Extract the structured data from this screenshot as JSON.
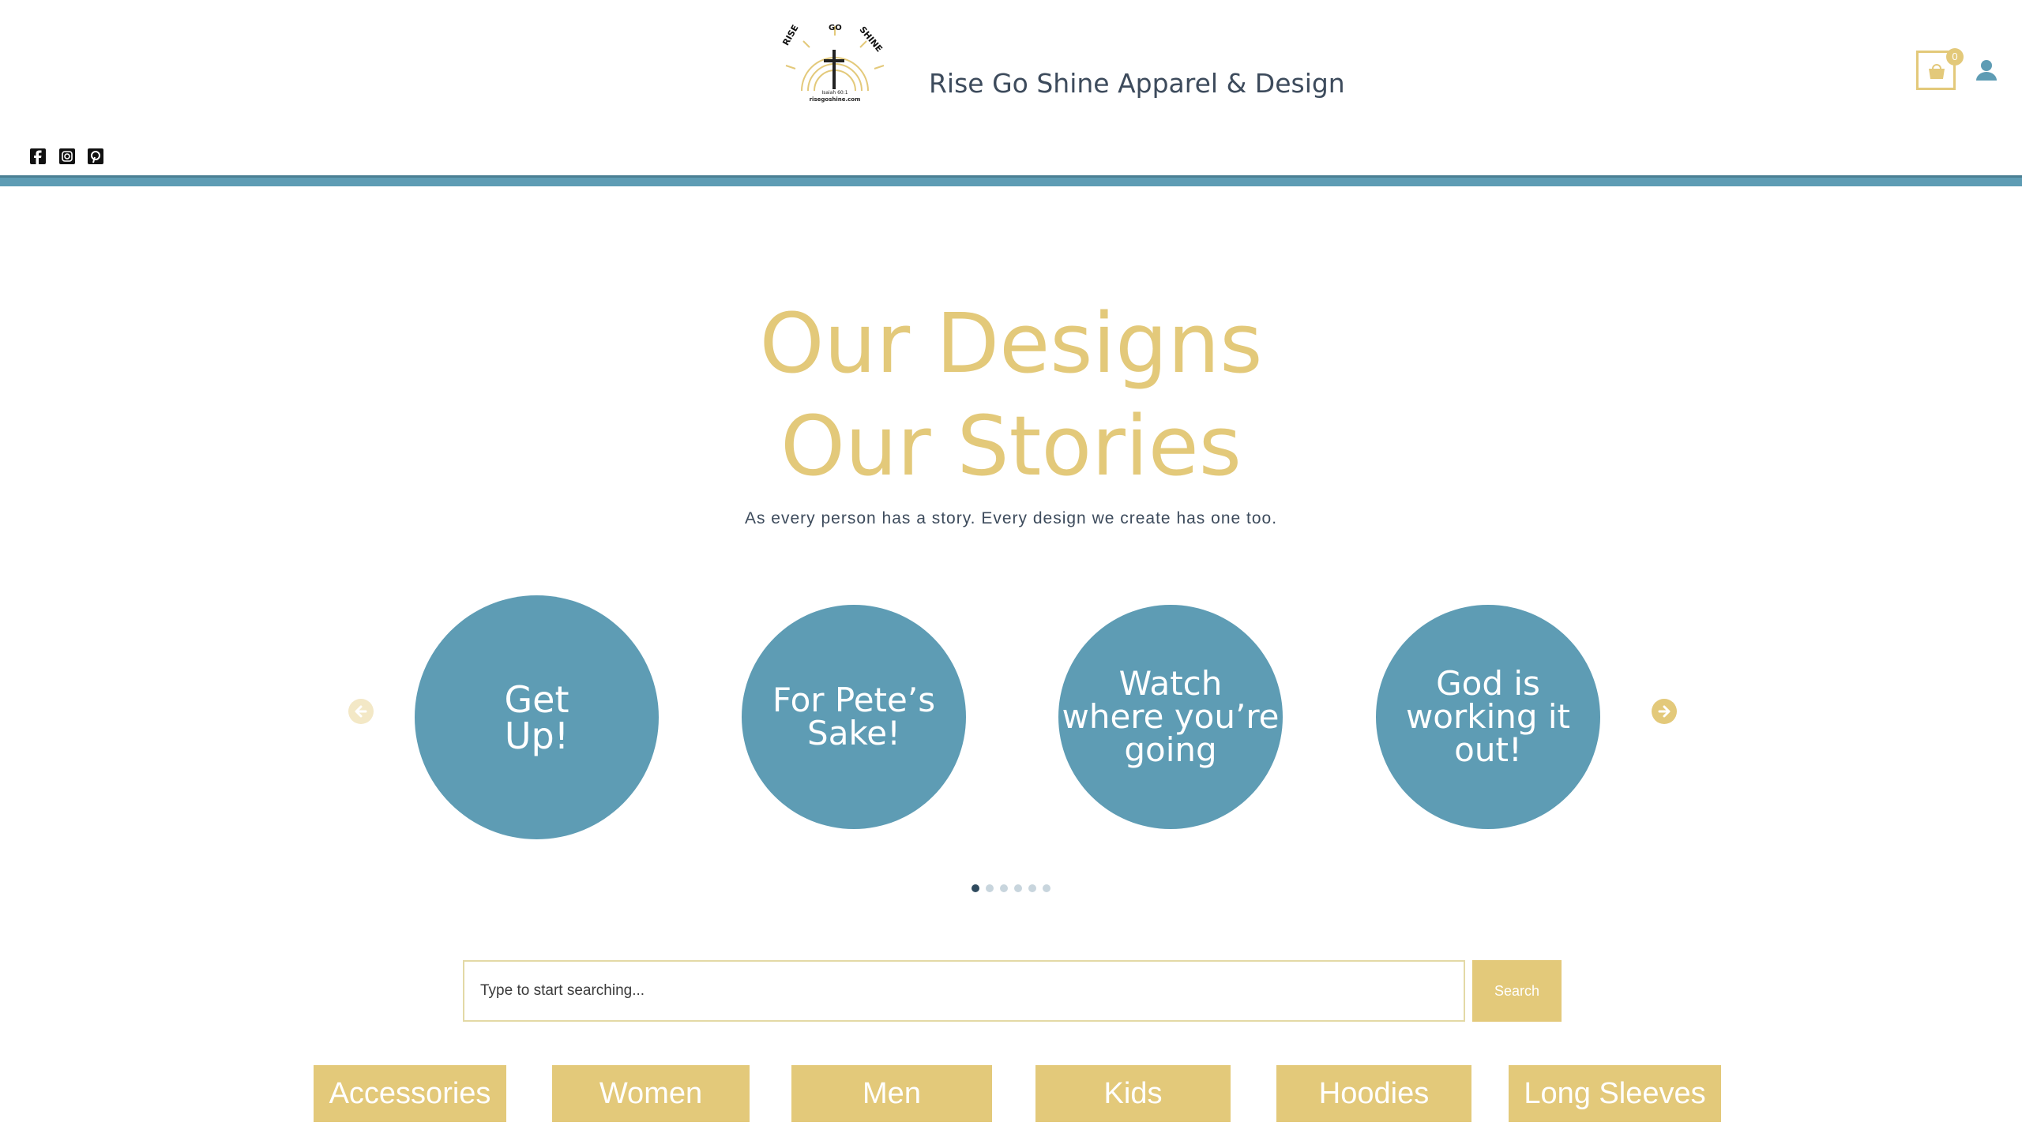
{
  "header": {
    "site_title": "Rise Go Shine Apparel & Design",
    "logo_text": [
      "RISE",
      "GO",
      "SHINE",
      "Isaiah 60:1",
      "risegoshine.com"
    ],
    "cart_count": "0",
    "icons": [
      "cart-icon",
      "user-icon",
      "facebook-icon",
      "instagram-icon",
      "pinterest-icon"
    ]
  },
  "hero": {
    "title_line1": "Our Designs",
    "title_line2": "Our Stories",
    "subtitle": "As every person has a story. Every design we create has one too."
  },
  "carousel": {
    "slides": [
      {
        "line1": "Get",
        "line2": "Up!",
        "line3": ""
      },
      {
        "line1": "For Pete’s",
        "line2": "Sake!",
        "line3": ""
      },
      {
        "line1": "Watch",
        "line2": "where you’re",
        "line3": "going"
      },
      {
        "line1": "God is",
        "line2": "working it",
        "line3": "out!"
      }
    ],
    "dot_count": 6,
    "active_dot": 0,
    "icons": [
      "arrow-left-icon",
      "arrow-right-icon"
    ]
  },
  "search": {
    "placeholder": "Type to start searching...",
    "button_label": "Search"
  },
  "categories": [
    "Accessories",
    "Women",
    "Men",
    "Kids",
    "Hoodies",
    "Long Sleeves"
  ],
  "colors": {
    "accent_gold": "#e3c97a",
    "accent_blue": "#5e9cb4",
    "text_dark": "#3d4b5c"
  }
}
